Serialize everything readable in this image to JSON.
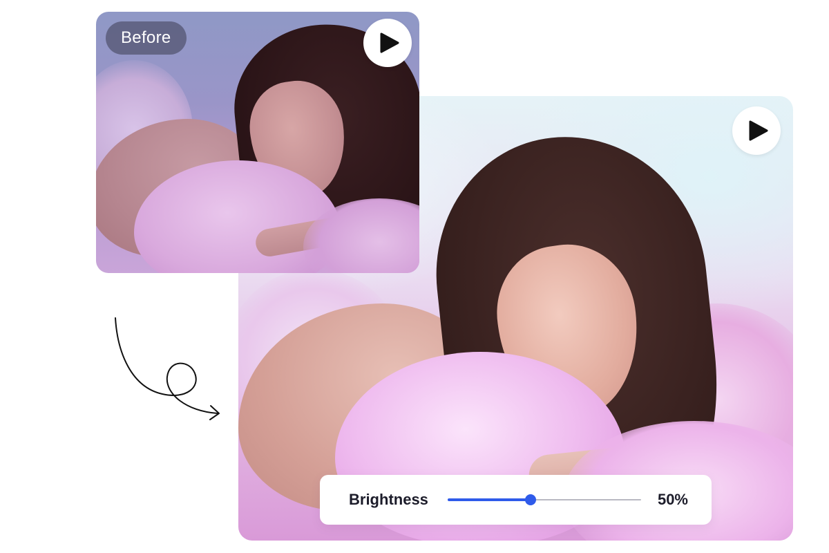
{
  "before_card": {
    "badge_label": "Before",
    "play_icon": "play-icon"
  },
  "after_card": {
    "play_icon": "play-icon"
  },
  "brightness": {
    "label": "Brightness",
    "value_text": "50%",
    "value_fraction": 0.43
  },
  "colors": {
    "accent": "#2f5bea",
    "badge_bg": "#50526e",
    "text": "#1c1c2a"
  }
}
